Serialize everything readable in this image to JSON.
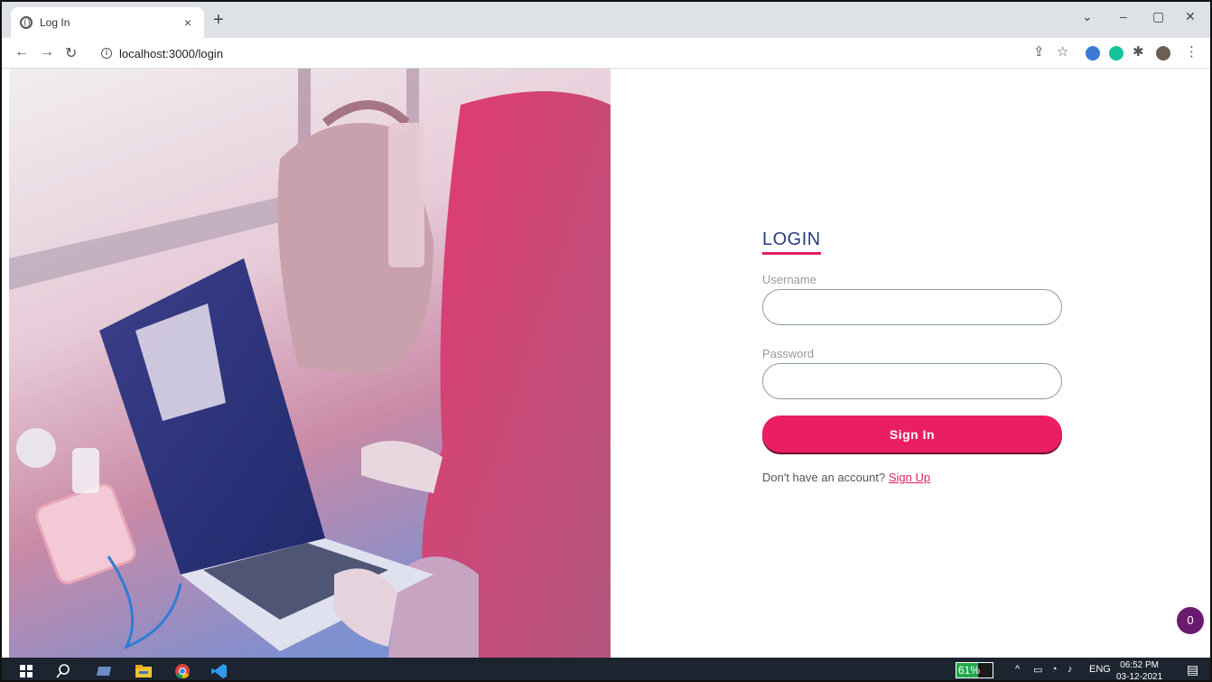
{
  "browser": {
    "tab_title": "Log In",
    "tab_close": "×",
    "new_tab": "+",
    "url": "localhost:3000/login",
    "window_controls": {
      "minimize": "–",
      "maximize": "▢",
      "close": "✕",
      "menu": "⌄"
    }
  },
  "login": {
    "title": "LOGIN",
    "username_label": "Username",
    "username_value": "",
    "password_label": "Password",
    "password_value": "",
    "signin_label": "Sign In",
    "signup_prompt": "Don't have an account?",
    "signup_link": "Sign Up"
  },
  "fab": {
    "count": "0"
  },
  "taskbar": {
    "battery_percent": 61,
    "battery_text": "61%",
    "language": "ENG",
    "time": "06:52 PM",
    "date": "03-12-2021"
  },
  "colors": {
    "accent": "#ea1e63",
    "title": "#2c3a82",
    "fab": "#6a1b6f",
    "taskbar": "#1c2430"
  },
  "icons": {
    "tab": "globe-icon",
    "back": "back-arrow-icon",
    "forward": "forward-arrow-icon",
    "reload": "reload-icon",
    "site_info": "info-icon",
    "share": "share-icon",
    "bookmark": "star-icon",
    "extensions": "puzzle-icon",
    "menu": "kebab-menu-icon"
  }
}
